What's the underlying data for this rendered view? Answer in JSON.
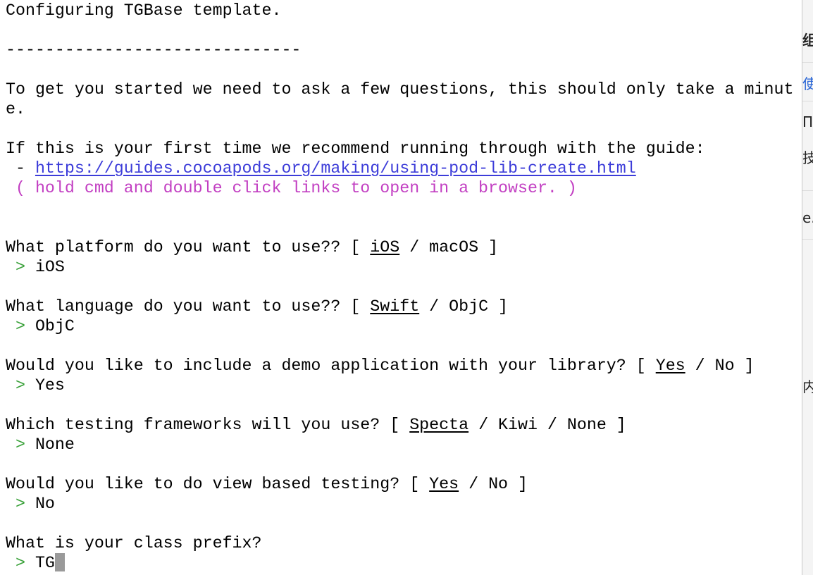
{
  "terminal": {
    "header": "Configuring TGBase template.",
    "divider": "------------------------------",
    "intro_line1": "To get you started we need to ask a few questions, this should only take a minut",
    "intro_line2": "e.",
    "guide_line": "If this is your first time we recommend running through with the guide:",
    "guide_bullet": " - ",
    "guide_link": "https://guides.cocoapods.org/making/using-pod-lib-create.html",
    "hint": " ( hold cmd and double click links to open in a browser. )",
    "prompt_symbol": " > ",
    "questions": [
      {
        "prefix": "What platform do you want to use?? [ ",
        "default_option": "iOS",
        "rest": " / macOS ]",
        "answer": "iOS"
      },
      {
        "prefix": "What language do you want to use?? [ ",
        "default_option": "Swift",
        "rest": " / ObjC ]",
        "answer": "ObjC"
      },
      {
        "prefix": "Would you like to include a demo application with your library? [ ",
        "default_option": "Yes",
        "rest": " / No ]",
        "answer": "Yes"
      },
      {
        "prefix": "Which testing frameworks will you use? [ ",
        "default_option": "Specta",
        "rest": " / Kiwi / None ]",
        "answer": "None"
      },
      {
        "prefix": "Would you like to do view based testing? [ ",
        "default_option": "Yes",
        "rest": " / No ]",
        "answer": "No"
      }
    ],
    "final_question": "What is your class prefix?",
    "current_input": "TG"
  },
  "background_window": {
    "fragments": [
      "组",
      "使",
      "П",
      "技",
      "e.",
      "内"
    ]
  },
  "colors": {
    "link": "#3c3cd9",
    "hint": "#c23fc2",
    "prompt": "#3aa13a",
    "cursor": "#9a9a9a"
  }
}
